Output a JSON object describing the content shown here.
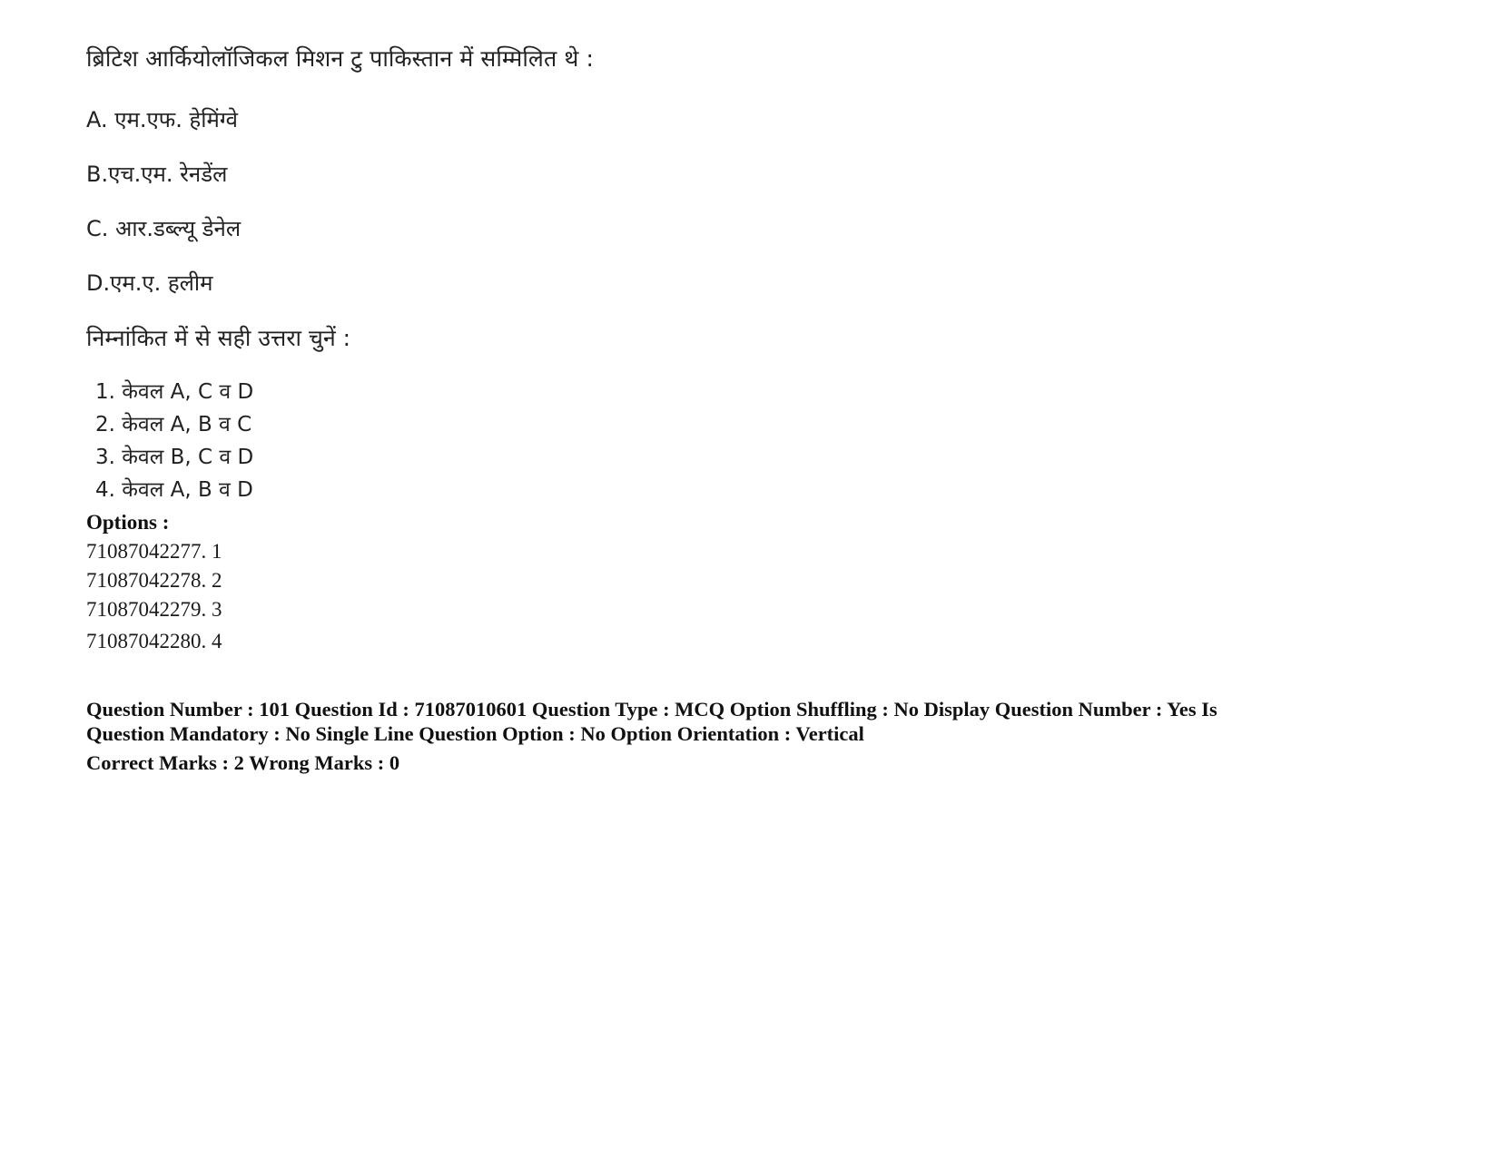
{
  "document": {
    "type": "exam-question-page",
    "background_color": "#ffffff",
    "text_color": "#1a1a1a"
  },
  "question": {
    "stem": "ब्रिटिश आर्कियोलॉजिकल मिशन टु पाकिस्तान में सम्मिलित थे :",
    "statements": [
      "A. एम.एफ. हेमिंग्वे",
      "B.एच.एम. रेनडेंल",
      "C. आर.डब्ल्यू डेनेल",
      "D.एम.ए. हलीम"
    ],
    "choose_prompt": "निम्नांकित में से सही उत्तरा चुनें :",
    "alternatives": [
      "1. केवल A, C व D",
      "2. केवल A, B व C",
      "3. केवल B, C व D",
      "4. केवल A, B व D"
    ]
  },
  "options": {
    "label": "Options :",
    "rows": [
      "71087042277. 1",
      "71087042278. 2",
      "71087042279. 3",
      "71087042280. 4"
    ]
  },
  "metadata": {
    "line1": "Question Number : 101 Question Id : 71087010601 Question Type : MCQ Option Shuffling : No Display Question Number : Yes Is",
    "line2": "Question Mandatory : No Single Line Question Option : No Option Orientation : Vertical",
    "line3": "Correct Marks : 2 Wrong Marks : 0"
  }
}
